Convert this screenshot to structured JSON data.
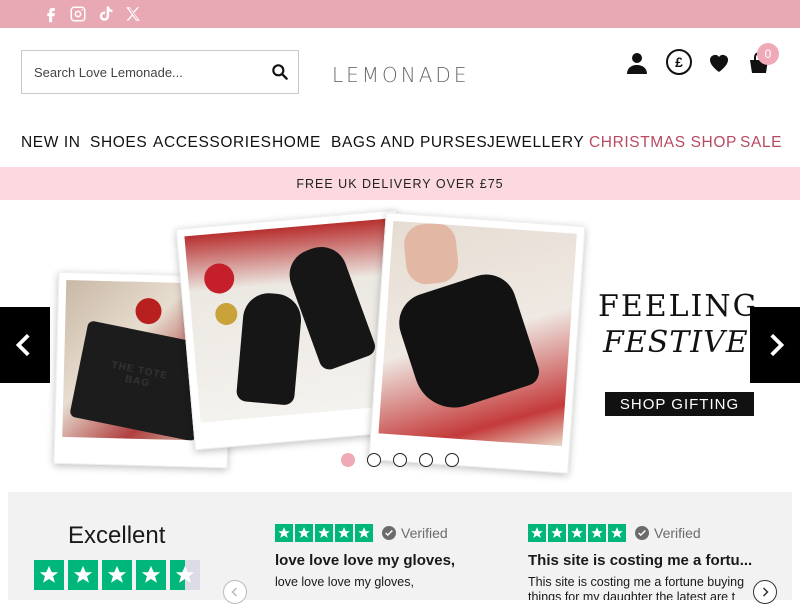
{
  "topbar": {
    "social": [
      "facebook-icon",
      "instagram-icon",
      "tiktok-icon",
      "x-icon"
    ],
    "bg_color": "#e8a9b4"
  },
  "header": {
    "search_placeholder": "Search Love Lemonade...",
    "logo": "LEMONADE",
    "icons": [
      "account-icon",
      "currency-icon",
      "wishlist-icon",
      "cart-icon"
    ],
    "currency_symbol": "£",
    "cart_count": "0"
  },
  "nav": {
    "items": [
      "NEW IN",
      "SHOES",
      "ACCESSORIES",
      "HOME",
      "BAGS AND PURSES",
      "JEWELLERY",
      "CHRISTMAS SHOP",
      "SALE"
    ],
    "highlight_color": "#b84a62"
  },
  "delivery_banner": "FREE UK DELIVERY OVER £75",
  "hero": {
    "headline_1": "FEELING",
    "headline_2": "FESTIVE",
    "cta": "SHOP GIFTING",
    "bag_text": "THE TOTE BAG",
    "active_slide": 1,
    "slide_count": 5
  },
  "reviews": {
    "rating_label": "Excellent",
    "star_rating": 4.5,
    "verified_label": "Verified",
    "items": [
      {
        "title": "love love love my gloves,",
        "body": "love love love my gloves,"
      },
      {
        "title": "This site is costing me a fortu...",
        "body": "This site is costing me a fortune buying things for my daughter the latest are t"
      }
    ],
    "accent_color": "#00b67a"
  }
}
